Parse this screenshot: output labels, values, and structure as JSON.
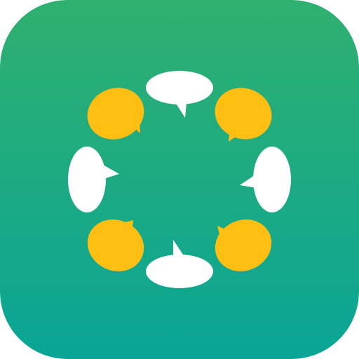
{
  "app_icon": {
    "icon_name": "chat-circle-app-icon",
    "colors": {
      "background_top": "#2fb06f",
      "background_bottom": "#0aa596",
      "bubble_yellow": "#ffbe12",
      "bubble_white": "#ffffff"
    },
    "bubbles": [
      {
        "name": "speech-bubble-top-icon",
        "color": "white",
        "direction": "down"
      },
      {
        "name": "speech-bubble-top-right-icon",
        "color": "yellow",
        "direction": "down-left"
      },
      {
        "name": "speech-bubble-right-icon",
        "color": "white",
        "direction": "left"
      },
      {
        "name": "speech-bubble-bottom-right-icon",
        "color": "yellow",
        "direction": "up-left"
      },
      {
        "name": "speech-bubble-bottom-icon",
        "color": "white",
        "direction": "up"
      },
      {
        "name": "speech-bubble-bottom-left-icon",
        "color": "yellow",
        "direction": "up-right"
      },
      {
        "name": "speech-bubble-left-icon",
        "color": "white",
        "direction": "right"
      },
      {
        "name": "speech-bubble-top-left-icon",
        "color": "yellow",
        "direction": "down-right"
      }
    ]
  }
}
